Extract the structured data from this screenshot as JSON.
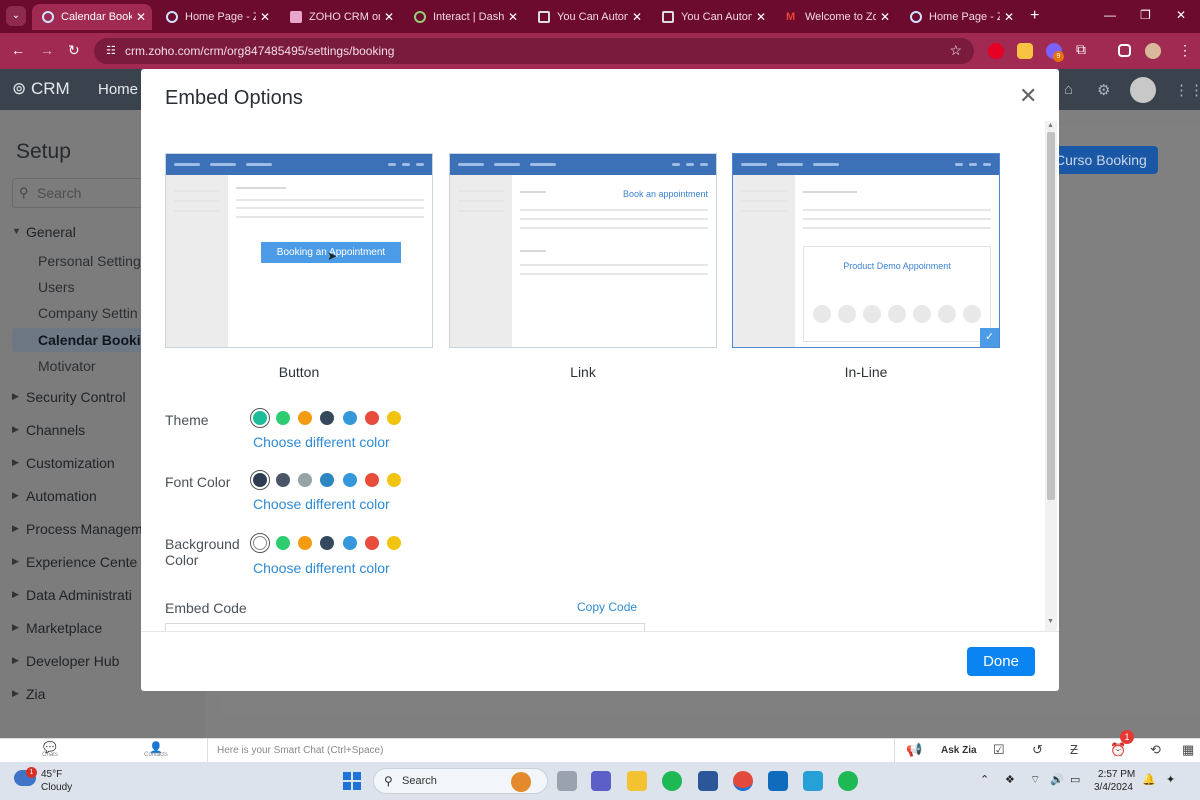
{
  "browser": {
    "tabs": [
      {
        "label": "Calendar Bookin",
        "active": true
      },
      {
        "label": "Home Page - Zo"
      },
      {
        "label": "ZOHO CRM on"
      },
      {
        "label": "Interact | Dashb"
      },
      {
        "label": "You Can Autom"
      },
      {
        "label": "You Can Autom"
      },
      {
        "label": "Welcome to Zo"
      },
      {
        "label": "Home Page - Zo"
      }
    ],
    "url": "crm.zoho.com/crm/org847485495/settings/booking",
    "extension_badge": "9"
  },
  "crm": {
    "logo": "CRM",
    "home": "Home",
    "bg_button": "Curso Booking"
  },
  "setup": {
    "title": "Setup",
    "search_placeholder": "Search",
    "sections": [
      {
        "label": "General",
        "expanded": true
      },
      {
        "label": "Security Control"
      },
      {
        "label": "Channels"
      },
      {
        "label": "Customization"
      },
      {
        "label": "Automation"
      },
      {
        "label": "Process Managem"
      },
      {
        "label": "Experience Cente"
      },
      {
        "label": "Data Administrati"
      },
      {
        "label": "Marketplace"
      },
      {
        "label": "Developer Hub"
      },
      {
        "label": "Zia"
      }
    ],
    "general_items": [
      "Personal Setting",
      "Users",
      "Company Settin",
      "Calendar Bookin",
      "Motivator"
    ],
    "selected_item": "Calendar Bookin"
  },
  "modal": {
    "title": "Embed Options",
    "options": [
      {
        "label": "Button",
        "preview_button": "Booking an Appointment"
      },
      {
        "label": "Link",
        "preview_link": "Book an appointment"
      },
      {
        "label": "In-Line",
        "preview_card": "Product Demo Appoinment",
        "selected": true
      }
    ],
    "theme": {
      "label": "Theme",
      "colors": [
        "#1dbd9b",
        "#2ecc71",
        "#f39c12",
        "#34495e",
        "#3498db",
        "#e74c3c",
        "#f1c40f"
      ],
      "selected_index": 0,
      "choose": "Choose different color"
    },
    "font_color": {
      "label": "Font Color",
      "colors": [
        "#2c3e50",
        "#4a5568",
        "#95a5a6",
        "#2e86c1",
        "#3498db",
        "#e74c3c",
        "#f1c40f"
      ],
      "selected_index": 0,
      "choose": "Choose different color"
    },
    "background_color": {
      "label": "Background Color",
      "colors": [
        "#ffffff",
        "#2ecc71",
        "#f39c12",
        "#34495e",
        "#3498db",
        "#e74c3c",
        "#f1c40f"
      ],
      "selected_index": 0,
      "choose": "Choose different color"
    },
    "embed_code_label": "Embed Code",
    "copy_code": "Copy Code",
    "done": "Done"
  },
  "zoho_bar": {
    "chats": "Chats",
    "contacts": "Contacts",
    "smart_chat_placeholder": "Here is your Smart Chat (Ctrl+Space)",
    "ask_zia": "Ask Zia",
    "notification_count": "1"
  },
  "taskbar": {
    "temp": "45°F",
    "weather": "Cloudy",
    "weather_badge": "1",
    "search": "Search",
    "time": "2:57 PM",
    "date": "3/4/2024"
  }
}
